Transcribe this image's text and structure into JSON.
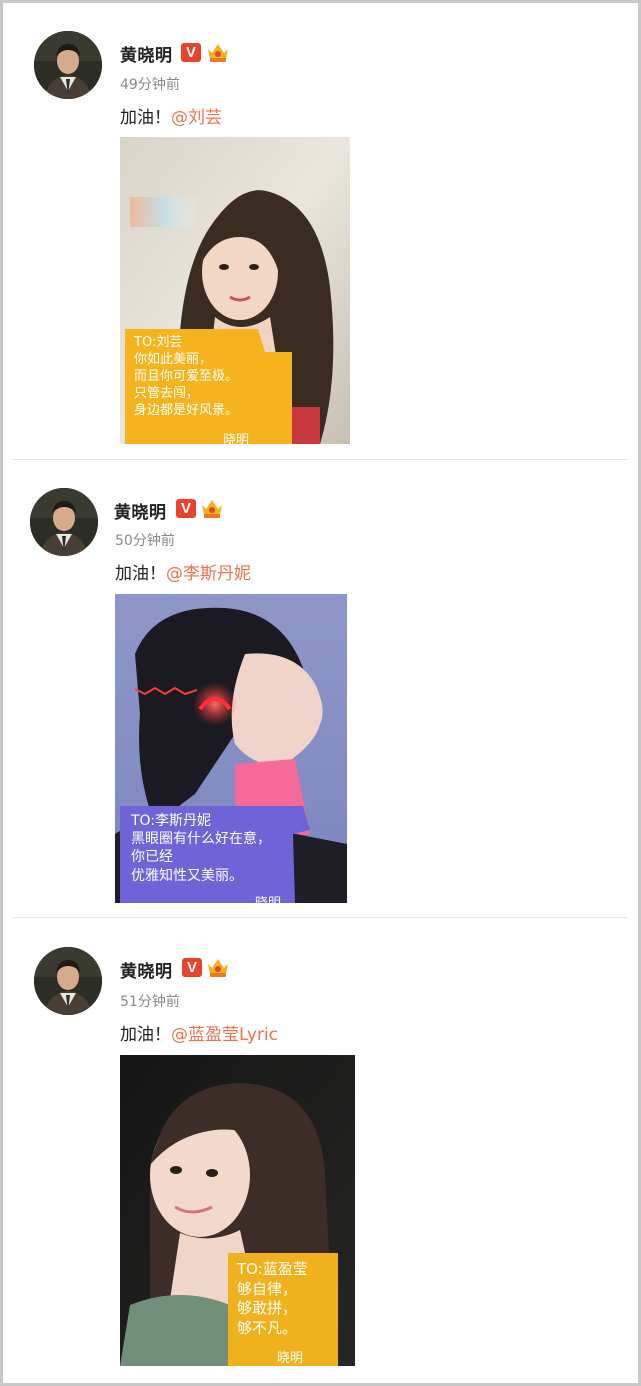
{
  "posts": [
    {
      "author": "黄晓明",
      "verified_badge": "V",
      "badge_icon": "crown-icon",
      "time": "49分钟前",
      "text_prefix": "加油！",
      "mention": "@刘芸",
      "note_lines": [
        "TO:刘芸",
        "你如此美丽，",
        "而且你可爱至极。",
        "只管去闯，",
        "身边都是好风景。"
      ],
      "signature": "晓明",
      "note_color": "#f5b41e"
    },
    {
      "author": "黄晓明",
      "verified_badge": "V",
      "badge_icon": "crown-icon",
      "time": "50分钟前",
      "text_prefix": "加油！",
      "mention": "@李斯丹妮",
      "note_lines": [
        "TO:李斯丹妮",
        "黑眼圈有什么好在意，",
        "你已经",
        "优雅知性又美丽。"
      ],
      "signature": "晓明",
      "note_color": "#6f63d8"
    },
    {
      "author": "黄晓明",
      "verified_badge": "V",
      "badge_icon": "crown-icon",
      "time": "51分钟前",
      "text_prefix": "加油！",
      "mention": "@蓝盈莹Lyric",
      "note_lines": [
        "TO:蓝盈莹",
        "够自律，",
        "够敢拼，",
        "够不凡。"
      ],
      "signature": "晓明",
      "note_color": "#f1b11c"
    }
  ],
  "colors": {
    "mention": "#eb7350",
    "verified": "#e8442c",
    "name": "#222222",
    "time": "#8a8a8a"
  }
}
